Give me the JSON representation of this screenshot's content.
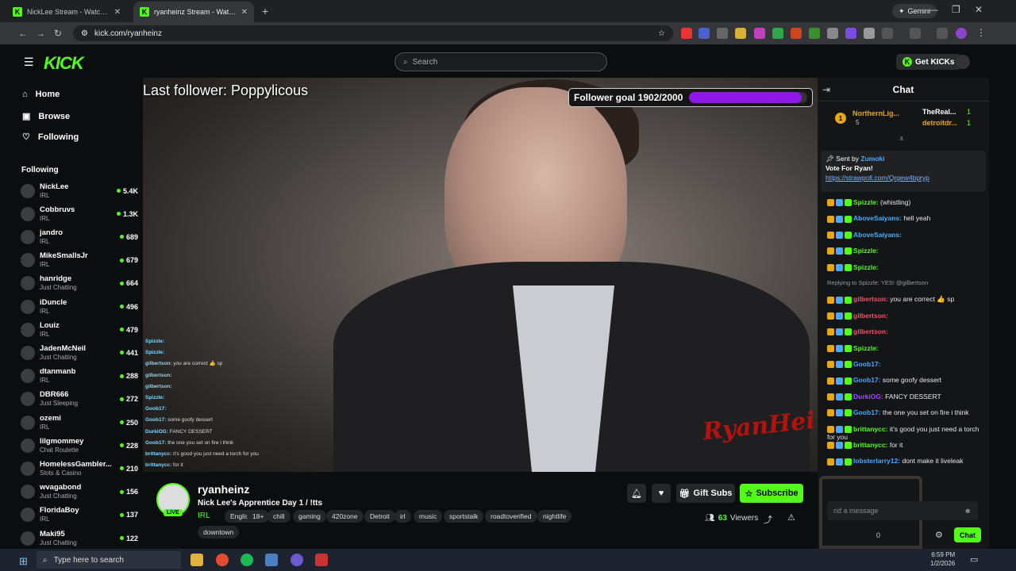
{
  "browser": {
    "tabs": [
      {
        "title": "NickLee Stream - Watch Live on",
        "active": false
      },
      {
        "title": "ryanheinz Stream - Watch Live o",
        "active": true
      }
    ],
    "new_tab": "+",
    "gemini": "Gemini",
    "url": "kick.com/ryanheinz"
  },
  "header": {
    "logo": "KICK",
    "search_placeholder": "Search",
    "get_kicks": "Get KICKs"
  },
  "nav": {
    "items": [
      {
        "label": "Home",
        "icon": "home-icon"
      },
      {
        "label": "Browse",
        "icon": "compass-icon"
      },
      {
        "label": "Following",
        "icon": "heart-icon"
      }
    ],
    "following_heading": "Following"
  },
  "channels": [
    {
      "name": "NickLee",
      "category": "IRL",
      "viewers": "5.4K"
    },
    {
      "name": "Cobbruvs",
      "category": "IRL",
      "viewers": "1.3K"
    },
    {
      "name": "jandro",
      "category": "IRL",
      "viewers": "689"
    },
    {
      "name": "MikeSmallsJr",
      "category": "IRL",
      "viewers": "679"
    },
    {
      "name": "hanridge",
      "category": "Just Chatting",
      "viewers": "664"
    },
    {
      "name": "iDuncle",
      "category": "IRL",
      "viewers": "496"
    },
    {
      "name": "Louiz",
      "category": "IRL",
      "viewers": "479"
    },
    {
      "name": "JadenMcNeil",
      "category": "Just Chatting",
      "viewers": "441"
    },
    {
      "name": "dtanmanb",
      "category": "IRL",
      "viewers": "288"
    },
    {
      "name": "DBR666",
      "category": "Just Sleeping",
      "viewers": "272"
    },
    {
      "name": "ozemi",
      "category": "IRL",
      "viewers": "250"
    },
    {
      "name": "lilgmommey",
      "category": "Chat Roulette",
      "viewers": "228"
    },
    {
      "name": "HomelessGambler...",
      "category": "Slots & Casino",
      "viewers": "210"
    },
    {
      "name": "wvagabond",
      "category": "Just Chatting",
      "viewers": "156"
    },
    {
      "name": "FloridaBoy",
      "category": "IRL",
      "viewers": "137"
    },
    {
      "name": "Maki95",
      "category": "Just Chatting",
      "viewers": "122"
    }
  ],
  "video": {
    "last_follower": "Last follower: Poppylicous",
    "follower_goal": "Follower goal 1902/2000",
    "goal_fraction": 0.951,
    "watermark": "RyanHeinz",
    "overlay_chat": [
      {
        "user": "Spizzle:",
        "text": ""
      },
      {
        "user": "Spizzle:",
        "text": ""
      },
      {
        "user": "gilbertson:",
        "text": "you are correct 👍 sp"
      },
      {
        "user": "gilbertson:",
        "text": ""
      },
      {
        "user": "gilbertson:",
        "text": ""
      },
      {
        "user": "Spizzle:",
        "text": ""
      },
      {
        "user": "Goob17:",
        "text": ""
      },
      {
        "user": "Goob17:",
        "text": "some goofy dessert"
      },
      {
        "user": "DurkiOG:",
        "text": "FANCY DESSERT"
      },
      {
        "user": "Goob17:",
        "text": "the one you set on fire i think"
      },
      {
        "user": "brittanycc:",
        "text": "it's good you just need a torch for you"
      },
      {
        "user": "brittanycc:",
        "text": "for it"
      }
    ]
  },
  "stream": {
    "name": "ryanheinz",
    "title": "Nick Lee's Apprentice Day 1 / !tts",
    "category": "IRL",
    "live": "LIVE",
    "tags": [
      "English",
      "18+",
      "chill",
      "gaming",
      "420zone",
      "Detroit",
      "irl",
      "music",
      "sportstalk",
      "roadtoverified",
      "nightlife",
      "downtown"
    ],
    "gift_subs": "Gift Subs",
    "subscribe": "Subscribe",
    "viewers": "63",
    "viewers_label": "Viewers"
  },
  "chat": {
    "title": "Chat",
    "gifters": [
      {
        "rank": "1",
        "name": "NorthernLig...",
        "count": "5"
      },
      {
        "name": "TheReal...",
        "count": "1"
      },
      {
        "name": "detroitdr...",
        "count": "1"
      }
    ],
    "pinned": {
      "sent_by": "Sent by",
      "sender": "Zumoki",
      "text": "Vote For Ryan!",
      "link": "https://strawpoll.com/Qrgew4bpryp"
    },
    "messages": [
      {
        "user": "Spizzle:",
        "text": "(whistling)",
        "color": "#53fc18"
      },
      {
        "user": "AboveSaiyans:",
        "text": "hell yeah",
        "color": "#3fb0ff"
      },
      {
        "user": "AboveSaiyans:",
        "text": "",
        "color": "#3fb0ff"
      },
      {
        "user": "Spizzle:",
        "text": "",
        "color": "#53fc18"
      },
      {
        "user": "Spizzle:",
        "text": "",
        "color": "#53fc18"
      },
      {
        "reply": "Replying to Spizzle: YES! @gilbertson"
      },
      {
        "user": "gilbertson:",
        "text": "you are correct 👍 sp",
        "color": "#ff4a6a"
      },
      {
        "user": "gilbertson:",
        "text": "",
        "color": "#ff4a6a"
      },
      {
        "user": "gilbertson:",
        "text": "",
        "color": "#ff4a6a"
      },
      {
        "user": "Spizzle:",
        "text": "",
        "color": "#53fc18"
      },
      {
        "user": "Goob17:",
        "text": "",
        "color": "#4aa8ff"
      },
      {
        "user": "Goob17:",
        "text": "some goofy dessert",
        "color": "#4aa8ff"
      },
      {
        "user": "DurkiOG:",
        "text": "FANCY DESSERT",
        "color": "#a24aff"
      },
      {
        "user": "Goob17:",
        "text": "the one you set on fire i think",
        "color": "#4aa8ff"
      },
      {
        "user": "brittanycc:",
        "text": "it's good you just need a torch for you",
        "color": "#53fc18"
      },
      {
        "user": "brittanycc:",
        "text": "for it",
        "color": "#53fc18"
      },
      {
        "user": "lobsterlarry12:",
        "text": "dont make it liveleak",
        "color": "#4aa8ff"
      }
    ],
    "input_placeholder": "nd a message",
    "send_label": "Chat",
    "points": "0"
  },
  "taskbar": {
    "search_placeholder": "Type here to search",
    "time": "6:59 PM",
    "date": "1/2/2026"
  },
  "colors": {
    "kick_green": "#53fc18",
    "goal_purple": "#8f18e8",
    "bg": "#0b0e0f"
  }
}
